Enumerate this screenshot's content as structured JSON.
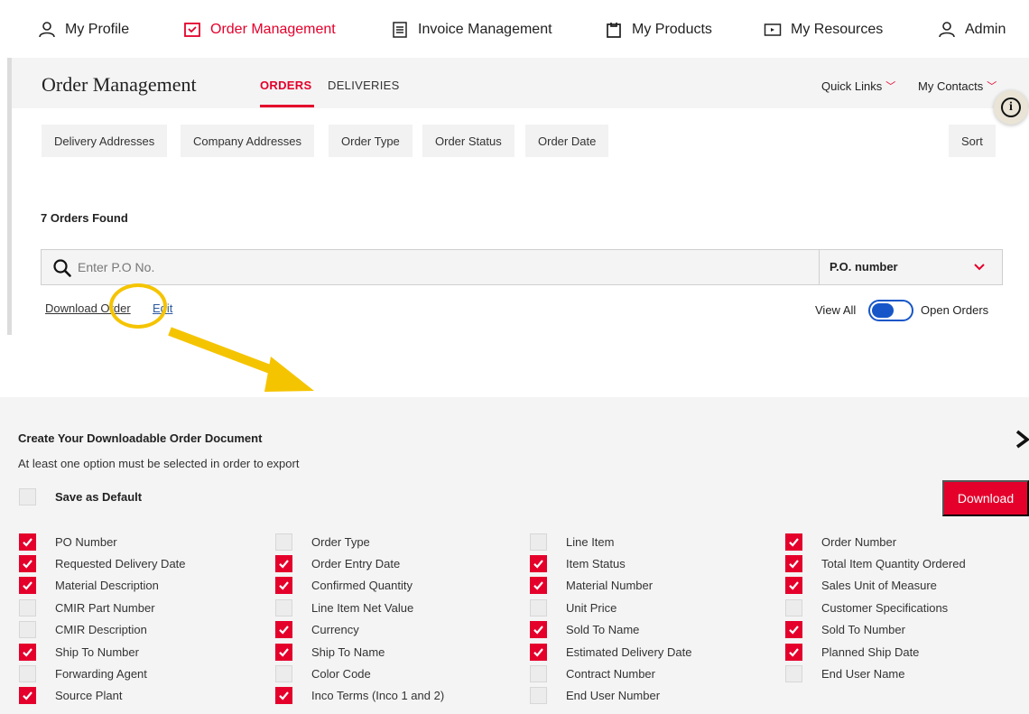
{
  "nav": {
    "items": [
      {
        "key": "profile",
        "label": "My Profile",
        "icon": "user-icon"
      },
      {
        "key": "orders",
        "label": "Order Management",
        "icon": "order-icon",
        "active": true
      },
      {
        "key": "invoices",
        "label": "Invoice Management",
        "icon": "invoice-icon"
      },
      {
        "key": "products",
        "label": "My Products",
        "icon": "clipboard-icon"
      },
      {
        "key": "resources",
        "label": "My Resources",
        "icon": "play-box-icon"
      },
      {
        "key": "admin",
        "label": "Admin",
        "icon": "user-icon"
      }
    ]
  },
  "header": {
    "title": "Order Management",
    "tabs": [
      {
        "label": "ORDERS",
        "active": true
      },
      {
        "label": "DELIVERIES"
      }
    ],
    "quick_links": "Quick Links",
    "my_contacts": "My Contacts"
  },
  "filters": {
    "items": [
      "Delivery Addresses",
      "Company Addresses",
      "Order Type",
      "Order Status",
      "Order Date"
    ],
    "sort": "Sort"
  },
  "results": {
    "found": "7 Orders Found"
  },
  "search": {
    "placeholder": "Enter P.O No.",
    "select_value": "P.O. number"
  },
  "actions": {
    "download_order": "Download Order",
    "edit": "Edit"
  },
  "toggle": {
    "left": "View All",
    "right": "Open Orders"
  },
  "panel": {
    "title": "Create Your Downloadable Order Document",
    "subtitle": "At least one option must be selected in order to export",
    "save_default": "Save as Default",
    "download": "Download",
    "columns": [
      [
        {
          "label": "PO Number",
          "checked": true
        },
        {
          "label": "Requested Delivery Date",
          "checked": true
        },
        {
          "label": "Material Description",
          "checked": true
        },
        {
          "label": "CMIR Part Number",
          "checked": false
        },
        {
          "label": "CMIR Description",
          "checked": false
        },
        {
          "label": "Ship To Number",
          "checked": true
        },
        {
          "label": "Forwarding Agent",
          "checked": false
        },
        {
          "label": "Source Plant",
          "checked": true
        }
      ],
      [
        {
          "label": "Order Type",
          "checked": false
        },
        {
          "label": "Order Entry Date",
          "checked": true
        },
        {
          "label": "Confirmed Quantity",
          "checked": true
        },
        {
          "label": "Line Item Net Value",
          "checked": false
        },
        {
          "label": "Currency",
          "checked": true
        },
        {
          "label": "Ship To Name",
          "checked": true
        },
        {
          "label": "Color Code",
          "checked": false
        },
        {
          "label": "Inco Terms (Inco 1 and 2)",
          "checked": true
        }
      ],
      [
        {
          "label": "Line Item",
          "checked": false
        },
        {
          "label": "Item Status",
          "checked": true
        },
        {
          "label": "Material Number",
          "checked": true
        },
        {
          "label": "Unit Price",
          "checked": false
        },
        {
          "label": "Sold To Name",
          "checked": true
        },
        {
          "label": "Estimated Delivery Date",
          "checked": true
        },
        {
          "label": "Contract Number",
          "checked": false
        },
        {
          "label": "End User Number",
          "checked": false
        }
      ],
      [
        {
          "label": "Order Number",
          "checked": true
        },
        {
          "label": "Total Item Quantity Ordered",
          "checked": true
        },
        {
          "label": "Sales Unit of Measure",
          "checked": true
        },
        {
          "label": "Customer Specifications",
          "checked": false
        },
        {
          "label": "Sold To Number",
          "checked": true
        },
        {
          "label": "Planned Ship Date",
          "checked": true
        },
        {
          "label": "End User Name",
          "checked": false
        }
      ]
    ]
  },
  "colors": {
    "accent": "#e4002b",
    "toggle": "#1656c8",
    "annotation": "#f5c400",
    "panel_bg": "#f4f4f4"
  }
}
